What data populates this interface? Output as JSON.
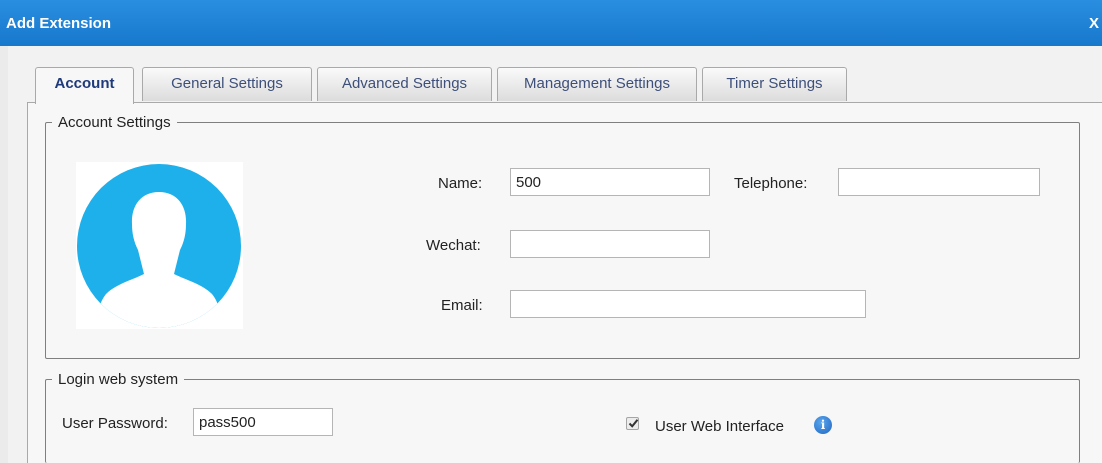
{
  "dialog": {
    "title": "Add Extension",
    "close_label": "X"
  },
  "tabs": [
    {
      "label": "Account",
      "active": true
    },
    {
      "label": "General Settings",
      "active": false
    },
    {
      "label": "Advanced Settings",
      "active": false
    },
    {
      "label": "Management Settings",
      "active": false
    },
    {
      "label": "Timer Settings",
      "active": false
    }
  ],
  "account_settings": {
    "legend": "Account Settings",
    "avatar_icon": "user-silhouette-icon",
    "name_label": "Name:",
    "name_value": "500",
    "telephone_label": "Telephone:",
    "telephone_value": "",
    "wechat_label": "Wechat:",
    "wechat_value": "",
    "email_label": "Email:",
    "email_value": ""
  },
  "login_web_system": {
    "legend": "Login web system",
    "password_label": "User Password:",
    "password_value": "pass500",
    "web_interface_label": "User Web Interface",
    "web_interface_checked": true,
    "info_icon": "info-icon"
  },
  "colors": {
    "titlebar": "#1778cc",
    "avatar_blue": "#1eb0ea",
    "tab_text": "#3d4f7a"
  }
}
